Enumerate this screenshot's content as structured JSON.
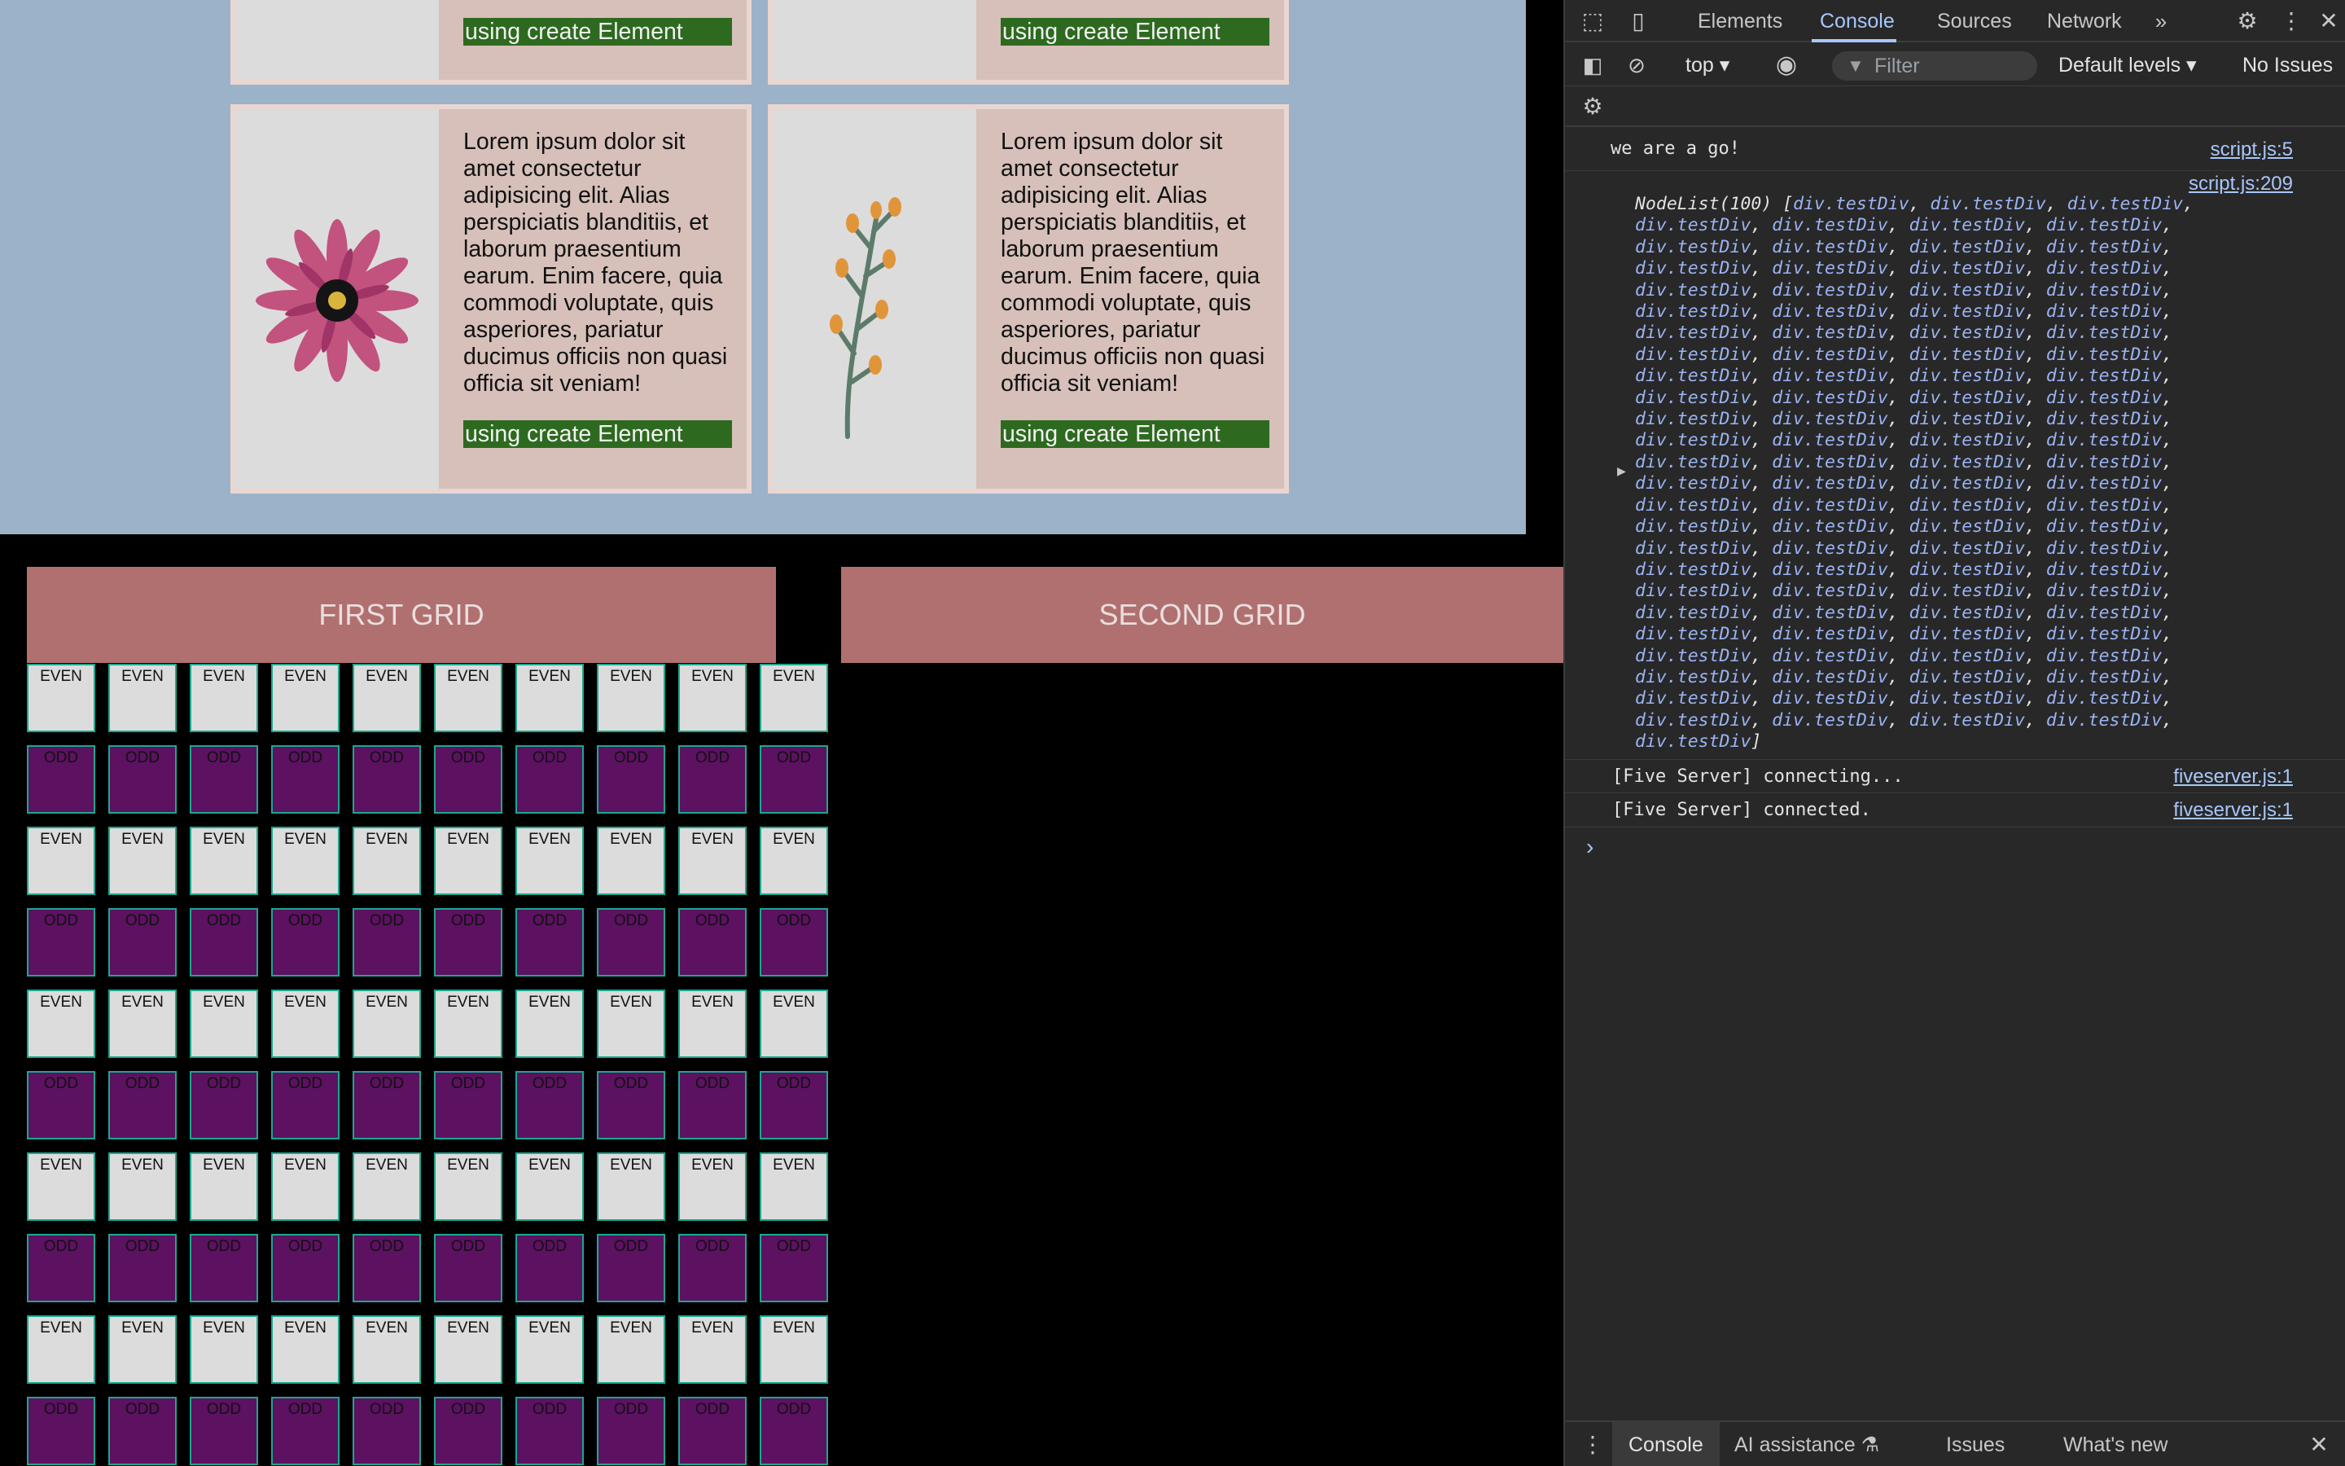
{
  "page": {
    "cards_top": [
      {
        "button": "using create Element"
      },
      {
        "button": "using create Element"
      }
    ],
    "cards_bottom": [
      {
        "image": "pink-flower-illustration",
        "text": "Lorem ipsum dolor sit amet consectetur adipisicing elit. Alias perspiciatis blanditiis, et laborum praesentium earum. Enim facere, quia commodi voluptate, quis asperiores, pariatur ducimus officiis non quasi officia sit veniam!",
        "button": "using create Element"
      },
      {
        "image": "orange-branch-illustration",
        "text": "Lorem ipsum dolor sit amet consectetur adipisicing elit. Alias perspiciatis blanditiis, et laborum praesentium earum. Enim facere, quia commodi voluptate, quis asperiores, pariatur ducimus officiis non quasi officia sit veniam!",
        "button": "using create Element"
      }
    ],
    "first_grid_title": "FIRST GRID",
    "second_grid_title": "SECOND GRID",
    "grid": {
      "columns": 10,
      "rows": 10,
      "even_label": "EVEN",
      "odd_label": "ODD",
      "row_pattern_starts_with": "EVEN"
    }
  },
  "devtools": {
    "tabs": [
      "Elements",
      "Console",
      "Sources",
      "Network"
    ],
    "active_tab": "Console",
    "more_tabs_icon": "double-chevron-icon",
    "context": "top",
    "filter_placeholder": "Filter",
    "levels": "Default levels",
    "issues": "No Issues",
    "logs": [
      {
        "message": "we are a go!",
        "source": "script.js:5"
      },
      {
        "message": "NodeList(100) [",
        "source": "script.js:209"
      },
      {
        "message": "[Five Server] connecting...",
        "source": "fiveserver.js:1"
      },
      {
        "message": "[Five Server] connected.",
        "source": "fiveserver.js:1"
      }
    ],
    "nodelist_item": "div.testDiv",
    "nodelist_count": 100,
    "nodelist_close": "]",
    "drawer_tabs": [
      "Console",
      "AI assistance",
      "Issues",
      "What's new"
    ],
    "drawer_active": "Console"
  },
  "colors": {
    "even": "#dcdcdc",
    "odd": "#5c1161",
    "grid_border": "#1aa890",
    "header": "#b07070",
    "card_section": "#9bb2c9",
    "create_button": "#2d6a1f",
    "link": "#a8c7fa"
  }
}
